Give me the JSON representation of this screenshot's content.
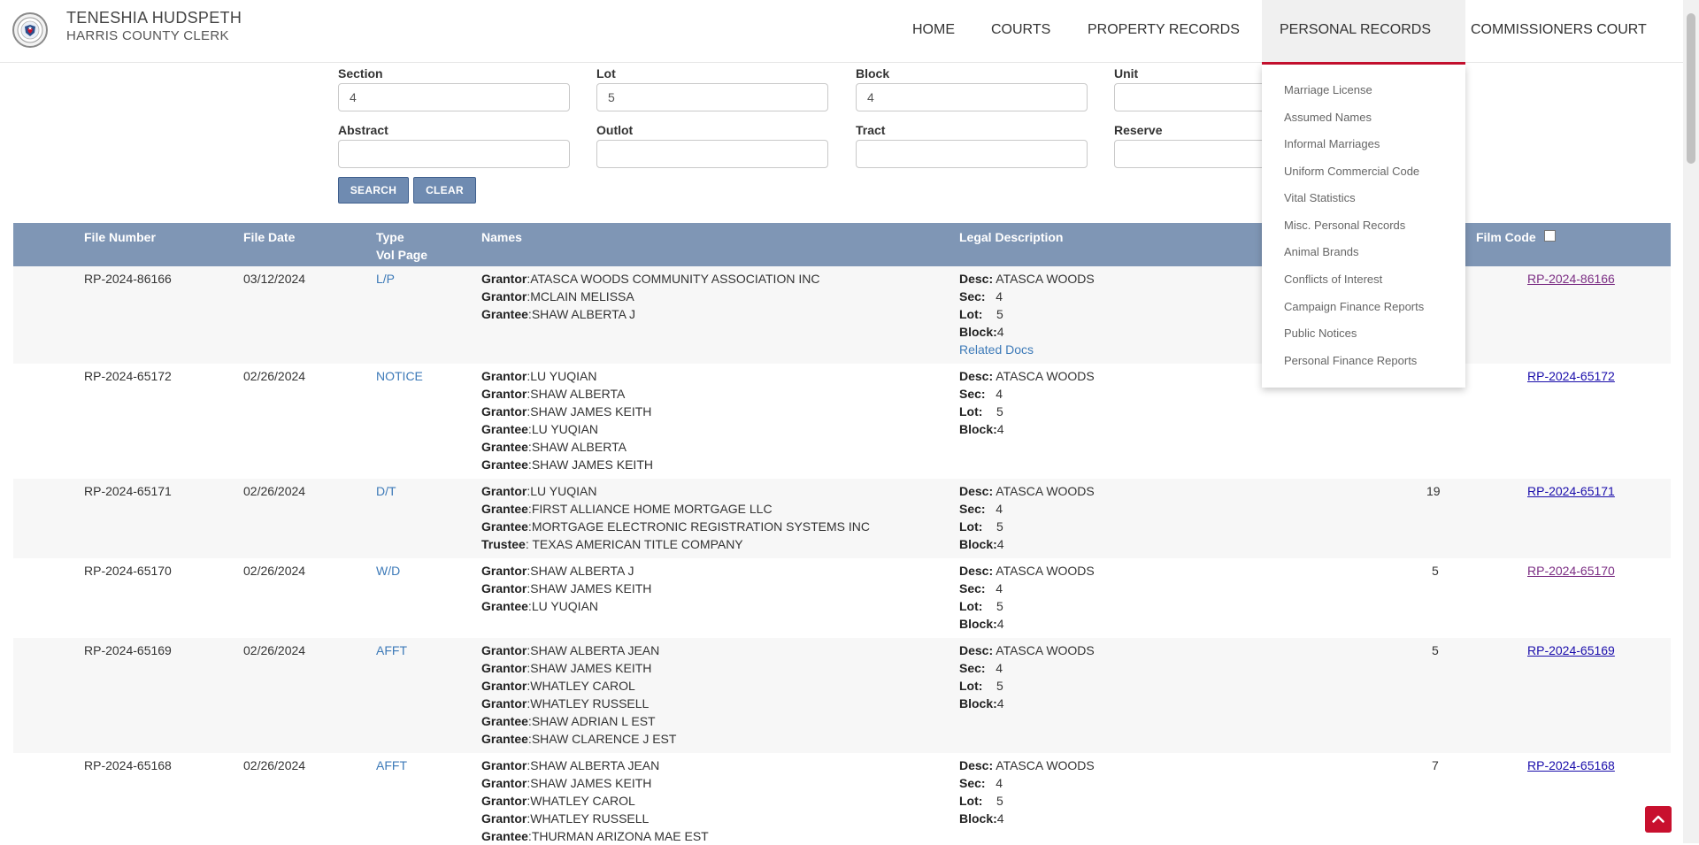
{
  "header": {
    "clerk_name": "TENESHIA HUDSPETH",
    "clerk_office": "HARRIS COUNTY CLERK",
    "logo_icon": "county-seal-icon",
    "nav": [
      {
        "label": "HOME"
      },
      {
        "label": "COURTS"
      },
      {
        "label": "PROPERTY RECORDS"
      },
      {
        "label": "PERSONAL RECORDS",
        "active": true
      },
      {
        "label": "COMMISSIONERS COURT"
      }
    ],
    "accent_color": "#c8102e"
  },
  "dropdown": {
    "items": [
      "Marriage License",
      "Assumed Names",
      "Informal Marriages",
      "Uniform Commercial Code",
      "Vital Statistics",
      "Misc. Personal Records",
      "Animal Brands",
      "Conflicts of Interest",
      "Campaign Finance Reports",
      "Public Notices",
      "Personal Finance Reports"
    ]
  },
  "search": {
    "section": {
      "label": "Section",
      "value": "4"
    },
    "lot": {
      "label": "Lot",
      "value": "5"
    },
    "block": {
      "label": "Block",
      "value": "4"
    },
    "unit": {
      "label": "Unit",
      "value": ""
    },
    "abstract": {
      "label": "Abstract",
      "value": ""
    },
    "outlot": {
      "label": "Outlot",
      "value": ""
    },
    "tract": {
      "label": "Tract",
      "value": ""
    },
    "reserve": {
      "label": "Reserve",
      "value": ""
    },
    "search_button": "SEARCH",
    "clear_button": "CLEAR"
  },
  "table": {
    "headers": {
      "file_number": "File Number",
      "file_date": "File Date",
      "type": "Type",
      "vol_page": "Vol Page",
      "names": "Names",
      "legal_description": "Legal Description",
      "film_code": "Film Code"
    },
    "rows": [
      {
        "file_number": "RP-2024-86166",
        "file_date": "03/12/2024",
        "type": "L/P",
        "names": [
          {
            "role": "Grantor",
            "name": "ATASCA WOODS COMMUNITY ASSOCIATION INC"
          },
          {
            "role": "Grantor",
            "name": "MCLAIN MELISSA"
          },
          {
            "role": "Grantee",
            "name": "SHAW ALBERTA J"
          }
        ],
        "legal": {
          "desc": "ATASCA WOODS",
          "sec": "4",
          "lot": "5",
          "block": "4"
        },
        "related": "Related Docs",
        "pages": "",
        "film_code": "RP-2024-86166",
        "visited": true
      },
      {
        "file_number": "RP-2024-65172",
        "file_date": "02/26/2024",
        "type": "NOTICE",
        "names": [
          {
            "role": "Grantor",
            "name": "LU YUQIAN"
          },
          {
            "role": "Grantor",
            "name": "SHAW ALBERTA"
          },
          {
            "role": "Grantor",
            "name": "SHAW JAMES KEITH"
          },
          {
            "role": "Grantee",
            "name": "LU YUQIAN"
          },
          {
            "role": "Grantee",
            "name": "SHAW ALBERTA"
          },
          {
            "role": "Grantee",
            "name": "SHAW JAMES KEITH"
          }
        ],
        "legal": {
          "desc": "ATASCA WOODS",
          "sec": "4",
          "lot": "5",
          "block": "4"
        },
        "pages": "",
        "film_code": "RP-2024-65172",
        "visited": false
      },
      {
        "file_number": "RP-2024-65171",
        "file_date": "02/26/2024",
        "type": "D/T",
        "names": [
          {
            "role": "Grantor",
            "name": "LU YUQIAN"
          },
          {
            "role": "Grantee",
            "name": "FIRST ALLIANCE HOME MORTGAGE LLC"
          },
          {
            "role": "Grantee",
            "name": "MORTGAGE ELECTRONIC REGISTRATION SYSTEMS INC"
          },
          {
            "role": "Trustee",
            "name": " TEXAS AMERICAN TITLE COMPANY"
          }
        ],
        "legal": {
          "desc": "ATASCA WOODS",
          "sec": "4",
          "lot": "5",
          "block": "4"
        },
        "pages": "19",
        "film_code": "RP-2024-65171",
        "visited": false
      },
      {
        "file_number": "RP-2024-65170",
        "file_date": "02/26/2024",
        "type": "W/D",
        "names": [
          {
            "role": "Grantor",
            "name": "SHAW ALBERTA J"
          },
          {
            "role": "Grantor",
            "name": "SHAW JAMES KEITH"
          },
          {
            "role": "Grantee",
            "name": "LU YUQIAN"
          }
        ],
        "legal": {
          "desc": "ATASCA WOODS",
          "sec": "4",
          "lot": "5",
          "block": "4"
        },
        "pages": "5",
        "film_code": "RP-2024-65170",
        "visited": true
      },
      {
        "file_number": "RP-2024-65169",
        "file_date": "02/26/2024",
        "type": "AFFT",
        "names": [
          {
            "role": "Grantor",
            "name": "SHAW ALBERTA JEAN"
          },
          {
            "role": "Grantor",
            "name": "SHAW JAMES KEITH"
          },
          {
            "role": "Grantor",
            "name": "WHATLEY CAROL"
          },
          {
            "role": "Grantor",
            "name": "WHATLEY RUSSELL"
          },
          {
            "role": "Grantee",
            "name": "SHAW ADRIAN L EST"
          },
          {
            "role": "Grantee",
            "name": "SHAW CLARENCE J EST"
          }
        ],
        "legal": {
          "desc": "ATASCA WOODS",
          "sec": "4",
          "lot": "5",
          "block": "4"
        },
        "pages": "5",
        "film_code": "RP-2024-65169",
        "visited": false
      },
      {
        "file_number": "RP-2024-65168",
        "file_date": "02/26/2024",
        "type": "AFFT",
        "names": [
          {
            "role": "Grantor",
            "name": "SHAW ALBERTA JEAN"
          },
          {
            "role": "Grantor",
            "name": "SHAW JAMES KEITH"
          },
          {
            "role": "Grantor",
            "name": "WHATLEY CAROL"
          },
          {
            "role": "Grantor",
            "name": "WHATLEY RUSSELL"
          },
          {
            "role": "Grantee",
            "name": "THURMAN ARIZONA MAE EST"
          }
        ],
        "legal": {
          "desc": "ATASCA WOODS",
          "sec": "4",
          "lot": "5",
          "block": "4"
        },
        "pages": "7",
        "film_code": "RP-2024-65168",
        "visited": false
      }
    ]
  },
  "back_to_top_icon": "chevron-up-icon"
}
